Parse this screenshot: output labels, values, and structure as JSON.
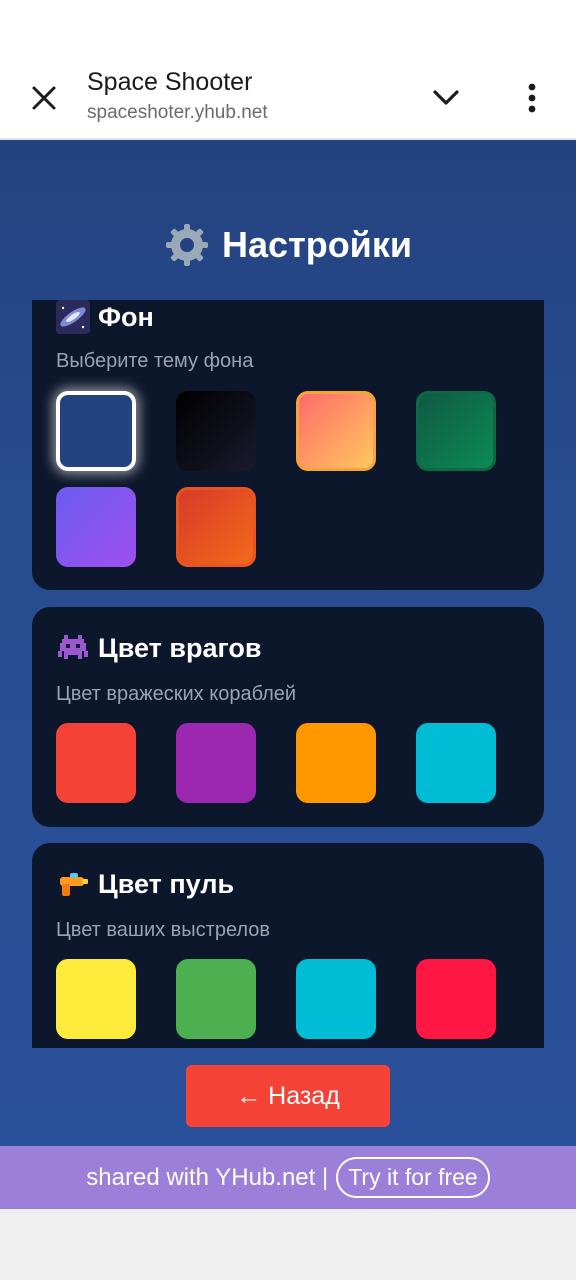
{
  "browser": {
    "title": "Space Shooter",
    "url": "spaceshoter.yhub.net"
  },
  "page": {
    "title": "Настройки"
  },
  "sections": {
    "background": {
      "title": "Фон",
      "subtitle": "Выберите тему фона",
      "selected": "dark-blue",
      "swatches": [
        "#24427f",
        "#0b0b14",
        "#ff7a66",
        "#0e6a4c",
        "#8b5cf6",
        "#ea4a1e"
      ]
    },
    "enemy": {
      "title": "Цвет врагов",
      "subtitle": "Цвет вражеских кораблей",
      "swatches": [
        "#f44336",
        "#9c27b0",
        "#ff9800",
        "#00bcd4"
      ]
    },
    "bullet": {
      "title": "Цвет пуль",
      "subtitle": "Цвет ваших выстрелов",
      "swatches": [
        "#ffeb3b",
        "#4caf50",
        "#00bcd4",
        "#ff1744"
      ]
    }
  },
  "back_button": "← Назад",
  "yhub": {
    "text": "shared with YHub.net |",
    "cta": "Try it for free"
  }
}
